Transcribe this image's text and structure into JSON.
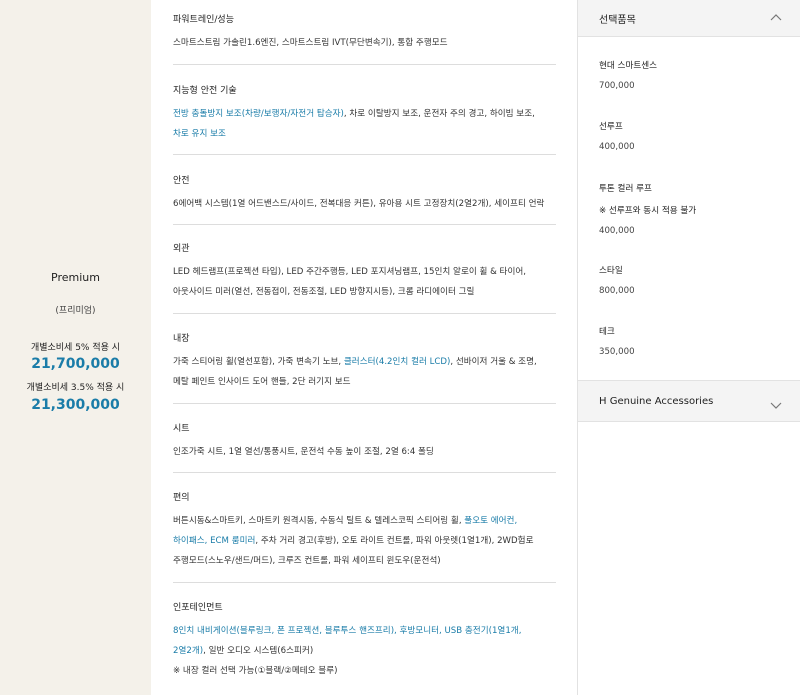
{
  "trim": {
    "name": "Premium",
    "name_ko": "(프리미엄)",
    "tax5_label": "개별소비세 5% 적용 시",
    "tax5_price": "21,700,000",
    "tax35_label": "개별소비세 3.5% 적용 시",
    "tax35_price": "21,300,000"
  },
  "specs": [
    {
      "title": "파워트레인/성능",
      "lines": [
        [
          {
            "t": "스마트스트림 가솔린1.6엔진, 스마트스트림 IVT(무단변속기), 통합 주행모드"
          }
        ]
      ]
    },
    {
      "title": "지능형 안전 기술",
      "lines": [
        [
          {
            "t": "전방 충돌방지 보조(차량/보행자/자전거 탑승자)",
            "hl": true
          },
          {
            "t": ", 차로 이탈방지 보조, 운전자 주의 경고, 하이빔 보조,"
          }
        ],
        [
          {
            "t": "차로 유지 보조",
            "hl": true
          }
        ]
      ]
    },
    {
      "title": "안전",
      "lines": [
        [
          {
            "t": "6에어백 시스템(1열 어드밴스드/사이드, 전복대응 커튼), 유아용 시트 고정장치(2열2개), 세이프티 언락"
          }
        ]
      ]
    },
    {
      "title": "외관",
      "lines": [
        [
          {
            "t": "LED 헤드램프(프로젝션 타입), LED 주간주행등, LED 포지셔닝램프, 15인치 알로이 휠 & 타이어,"
          }
        ],
        [
          {
            "t": "아웃사이드 미러(열선, 전동접이, 전동조절, LED 방향지시등), 크롬 라디에이터 그릴"
          }
        ]
      ]
    },
    {
      "title": "내장",
      "lines": [
        [
          {
            "t": "가죽 스티어링 휠(열선포함), 가죽 변속기 노브, "
          },
          {
            "t": "클러스터(4.2인치 컬러 LCD)",
            "hl": true
          },
          {
            "t": ", 선바이저 거울 & 조명,"
          }
        ],
        [
          {
            "t": "메탈 페인트 인사이드 도어 핸들, 2단 러기지 보드"
          }
        ]
      ]
    },
    {
      "title": "시트",
      "lines": [
        [
          {
            "t": "인조가죽 시트, 1열 열선/통풍시트, 운전석 수동 높이 조절, 2열 6:4 폴딩"
          }
        ]
      ]
    },
    {
      "title": "편의",
      "lines": [
        [
          {
            "t": "버튼시동&스마트키, 스마트키 원격시동, 수동식 틸트 & 텔레스코픽 스티어링 휠, "
          },
          {
            "t": "풀오토 에어컨,",
            "hl": true
          }
        ],
        [
          {
            "t": "하이패스, ECM 룸미러",
            "hl": true
          },
          {
            "t": ", 주차 거리 경고(후방), 오토 라이트 컨트롤, 파워 아웃렛(1열1개), 2WD험로"
          }
        ],
        [
          {
            "t": "주행모드(스노우/샌드/머드), 크루즈 컨트롤, 파워 세이프티 윈도우(운전석)"
          }
        ]
      ]
    },
    {
      "title": "인포테인먼트",
      "lines": [
        [
          {
            "t": "8인치 내비게이션(블루링크, 폰 프로젝션, 블루투스 핸즈프리), 후방모니터, USB 충전기(1열1개,",
            "hl": true
          }
        ],
        [
          {
            "t": "2열2개)",
            "hl": true
          },
          {
            "t": ", 일반 오디오 시스템(6스피커)"
          }
        ],
        [
          {
            "t": "※ 내장 컬러 선택 가능(①블랙/②메테오 블루)"
          }
        ]
      ]
    }
  ],
  "options_panel": {
    "title": "선택품목",
    "items": [
      {
        "name": "현대 스마트센스",
        "price": "700,000"
      },
      {
        "name": "선루프",
        "price": "400,000"
      },
      {
        "name": "투톤 컬러 루프",
        "note": "※ 선루프와 동시 적용 불가",
        "price": "400,000"
      },
      {
        "name": "스타일",
        "price": "800,000"
      },
      {
        "name": "테크",
        "price": "350,000"
      }
    ]
  },
  "accessories_panel": {
    "title": "H Genuine Accessories"
  },
  "colors": {
    "accent": "#1a7ca8",
    "left_bg": "#f4f1ea"
  }
}
